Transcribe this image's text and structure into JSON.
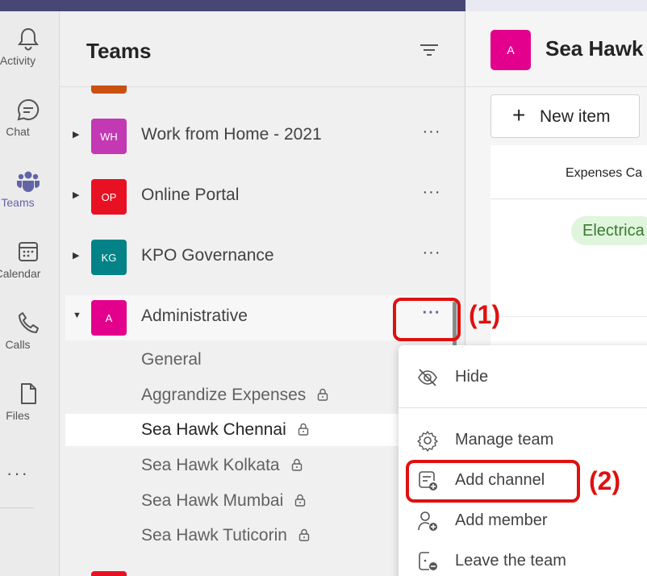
{
  "rail": {
    "items": [
      {
        "label": "Activity",
        "icon": "bell-icon"
      },
      {
        "label": "Chat",
        "icon": "chat-icon"
      },
      {
        "label": "Teams",
        "icon": "teams-icon"
      },
      {
        "label": "Calendar",
        "icon": "calendar-icon"
      },
      {
        "label": "Calls",
        "icon": "phone-icon"
      },
      {
        "label": "Files",
        "icon": "file-icon"
      }
    ],
    "more": "···"
  },
  "panel": {
    "title": "Teams",
    "teams": [
      {
        "initials": "WH",
        "name": "Work from Home - 2021",
        "color": "#c239b3"
      },
      {
        "initials": "OP",
        "name": "Online Portal",
        "color": "#e81123"
      },
      {
        "initials": "KG",
        "name": "KPO Governance",
        "color": "#038387"
      },
      {
        "initials": "A",
        "name": "Administrative",
        "color": "#e3008c"
      }
    ],
    "more_label": "···",
    "channels": [
      {
        "name": "General"
      },
      {
        "name": "Aggrandize Expenses"
      },
      {
        "name": "Sea Hawk Chennai"
      },
      {
        "name": "Sea Hawk Kolkata"
      },
      {
        "name": "Sea Hawk Mumbai"
      },
      {
        "name": "Sea Hawk Tuticorin"
      }
    ]
  },
  "content": {
    "avatar": "A",
    "title": "Sea Hawk",
    "new_item": "New item",
    "column_header": "Expenses Ca",
    "tag": "Electrica"
  },
  "menu": {
    "items": [
      {
        "label": "Hide",
        "icon": "eye-off-icon"
      },
      {
        "label": "Manage team",
        "icon": "gear-icon"
      },
      {
        "label": "Add channel",
        "icon": "add-channel-icon"
      },
      {
        "label": "Add member",
        "icon": "add-person-icon"
      },
      {
        "label": "Leave the team",
        "icon": "leave-icon"
      }
    ]
  },
  "annotations": {
    "step1": "(1)",
    "step2": "(2)",
    "color": "#e01010"
  },
  "colors": {
    "brand": "#6264a7",
    "topbar": "#464775"
  }
}
